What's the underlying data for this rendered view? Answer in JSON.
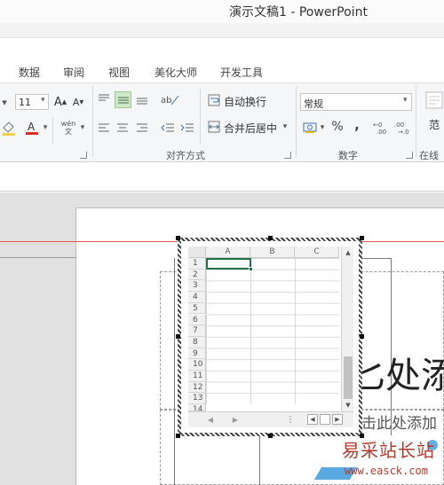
{
  "title_bar": {
    "title": "演示文稿1 - PowerPoint"
  },
  "tabs": [
    "数据",
    "审阅",
    "视图",
    "美化大师",
    "开发工具"
  ],
  "ribbon": {
    "font_size": "11",
    "wen_button": "wén\n文",
    "wrap_text": "自动换行",
    "merge_center": "合并后居中",
    "number_format": "常规",
    "percent": "%",
    "comma": ",",
    "styles_partial": "范",
    "online_partial": "在线",
    "group_alignment": "对齐方式",
    "group_number": "数字",
    "font_color": "#e02a2a",
    "highlight_color": "#f4d13d",
    "active_align_bg": "#cfe8c9"
  },
  "sheet": {
    "columns": [
      "A",
      "B",
      "C"
    ],
    "rows": [
      "1",
      "2",
      "3",
      "4",
      "5",
      "6",
      "7",
      "8",
      "9",
      "10",
      "11",
      "12",
      "13",
      "14"
    ],
    "active_cell": "A1",
    "accent_color": "#217346"
  },
  "slide": {
    "title_partial": "匕处添",
    "subtitle_partial": "击此处添加"
  },
  "watermark": {
    "line1": "易采站长站",
    "line2": "www.easck.com",
    "color": "#b23a2a"
  }
}
